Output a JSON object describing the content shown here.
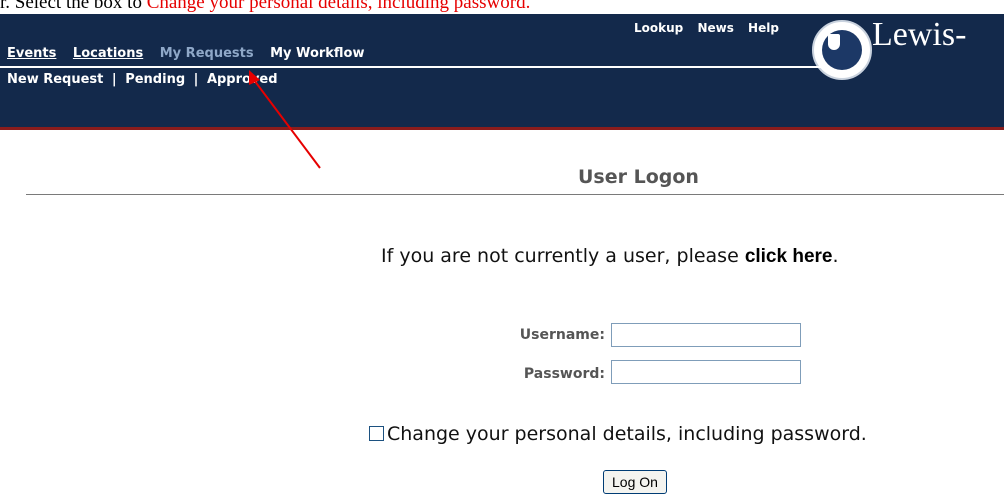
{
  "caption": {
    "prefix": "r. ",
    "part1": "Select the box to ",
    "part2": "Change your personal details, including password",
    "suffix": "."
  },
  "nav": {
    "events": "Events",
    "locations": "Locations",
    "my_requests": "My Requests",
    "my_workflow": "My Workflow"
  },
  "subnav": {
    "new_request": "New Request",
    "sep": "|",
    "pending": "Pending",
    "approved": "Approved"
  },
  "topnav": {
    "lookup": "Lookup",
    "news": "News",
    "help": "Help"
  },
  "brand": "Lewis-",
  "logon": {
    "title": "User Logon",
    "prompt_prefix": "If you are not currently a user, please ",
    "prompt_link": "click here",
    "prompt_suffix": ".",
    "username_label": "Username:",
    "password_label": "Password:",
    "username_value": "",
    "password_value": "",
    "checkbox_label": "Change your personal details, including password.",
    "button": "Log On"
  },
  "colors": {
    "header_bg": "#13294b",
    "accent_red": "#e60000",
    "rule_red": "#8a1c1c"
  }
}
